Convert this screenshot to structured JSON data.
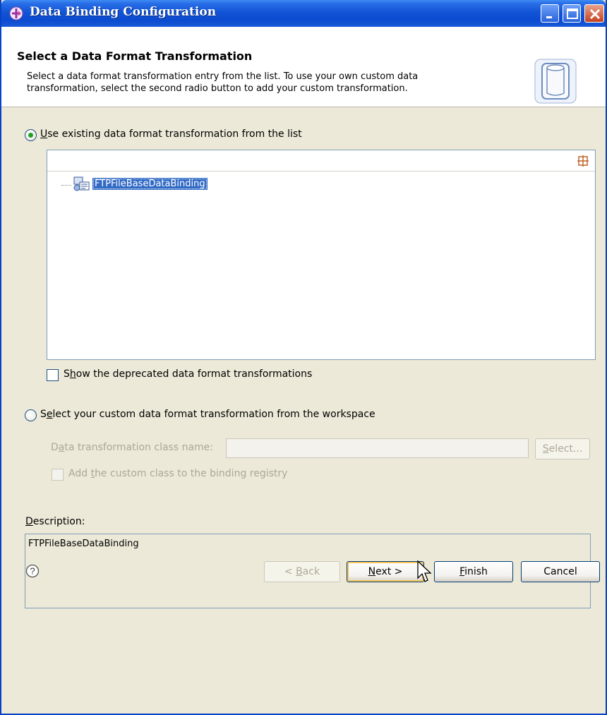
{
  "window": {
    "title": "Data Binding Configuration"
  },
  "banner": {
    "heading": "Select a Data Format Transformation",
    "description_line1": "Select a data format transformation entry from the list.  To use your own custom data",
    "description_line2": "transformation, select the second radio button to add your custom transformation."
  },
  "options": {
    "existing": {
      "label_mnemonic": "U",
      "label_rest": "se existing data format transformation from the list",
      "selected": true
    },
    "tree": {
      "items": [
        {
          "label": "FTPFileBaseDataBinding",
          "selected": true
        }
      ]
    },
    "deprecated": {
      "label_prefix": "S",
      "label_mnemonic": "h",
      "label_rest": "ow the deprecated data format transformations",
      "checked": false
    },
    "custom": {
      "label_prefix": "S",
      "label_mnemonic": "e",
      "label_rest": "lect your custom data format transformation from the workspace",
      "selected": false
    },
    "class_name": {
      "label_prefix": "D",
      "label_mnemonic": "a",
      "label_rest": "ta transformation class name:",
      "value": "",
      "select_button_mnemonic": "S",
      "select_button_rest": "elect..."
    },
    "registry": {
      "label_prefix": "Add ",
      "label_mnemonic": "t",
      "label_rest": "he custom class to the binding registry",
      "checked": false
    }
  },
  "description": {
    "label_mnemonic": "D",
    "label_rest": "escription:",
    "text": "FTPFileBaseDataBinding"
  },
  "footer": {
    "back_prefix": "< ",
    "back_mnemonic": "B",
    "back_rest": "ack",
    "next_mnemonic": "N",
    "next_rest": "ext >",
    "finish_mnemonic": "F",
    "finish_rest": "inish",
    "cancel_label": "Cancel"
  },
  "colors": {
    "title_bar": "#1254d6",
    "selection": "#316ac5",
    "dialog_bg": "#ece9d8"
  }
}
